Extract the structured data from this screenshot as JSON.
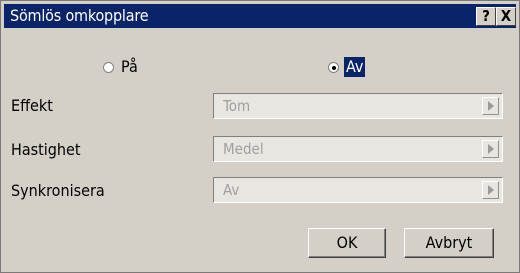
{
  "window": {
    "title": "Sömlös omkopplare",
    "help_label": "?",
    "close_label": "X"
  },
  "mode": {
    "options": [
      {
        "label": "På",
        "selected": false
      },
      {
        "label": "Av",
        "selected": true
      }
    ]
  },
  "fields": [
    {
      "label": "Effekt",
      "value": "Tom"
    },
    {
      "label": "Hastighet",
      "value": "Medel"
    },
    {
      "label": "Synkronisera",
      "value": "Av"
    }
  ],
  "buttons": {
    "ok_label": "OK",
    "cancel_label": "Avbryt"
  },
  "colors": {
    "titlebar": "#0a246a",
    "dialog_bg": "#d4d0c8",
    "disabled_text": "#a0a0a0"
  }
}
